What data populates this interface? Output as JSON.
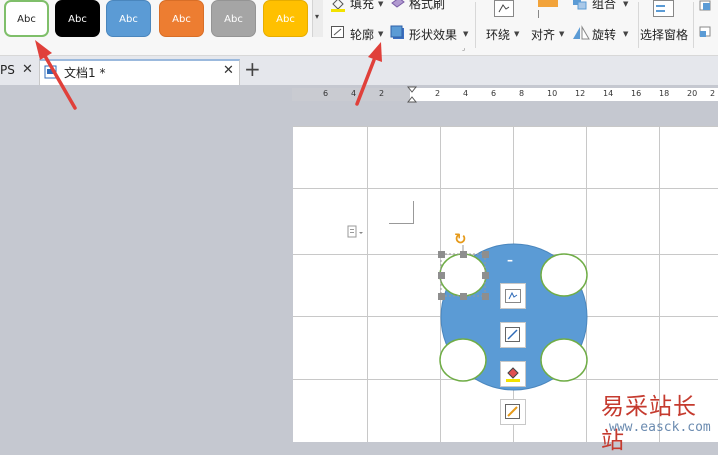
{
  "ribbon": {
    "style_presets": [
      {
        "label": "Abc",
        "fill": "#ffffff",
        "text_color": "#222222",
        "border": "#7fbf6a"
      },
      {
        "label": "Abc",
        "fill": "#000000",
        "text_color": "#ffffff",
        "border": "#000000"
      },
      {
        "label": "Abc",
        "fill": "#5b9bd5",
        "text_color": "#ffffff",
        "border": "#4a86bd"
      },
      {
        "label": "Abc",
        "fill": "#ed7d31",
        "text_color": "#ffffff",
        "border": "#d86e27"
      },
      {
        "label": "Abc",
        "fill": "#a5a5a5",
        "text_color": "#ffffff",
        "border": "#949494"
      },
      {
        "label": "Abc",
        "fill": "#ffc000",
        "text_color": "#ffffff",
        "border": "#e6ad00"
      }
    ],
    "fill_label": "填充",
    "format_painter_label": "格式刷",
    "outline_label": "轮廓",
    "shape_effect_label": "形状效果",
    "wrap_label": "环绕",
    "align_label": "对齐",
    "group_label": "组合",
    "rotate_label": "旋转",
    "selection_pane_label": "选择窗格"
  },
  "tabs": [
    {
      "label": "PS"
    },
    {
      "label": "文档1 *",
      "active": true
    }
  ],
  "ruler": {
    "labels": [
      "6",
      "4",
      "2",
      "2",
      "4",
      "6",
      "8",
      "10",
      "12",
      "14",
      "16",
      "18",
      "20",
      "2"
    ]
  },
  "float_toolbar": {
    "collapse_label": "–"
  },
  "watermark": {
    "title": "易采站长站",
    "url": "www.easck.com"
  },
  "colors": {
    "accent_red": "#e0403a",
    "shape_blue": "#5b9bd5",
    "circle_border": "#70ad47"
  }
}
